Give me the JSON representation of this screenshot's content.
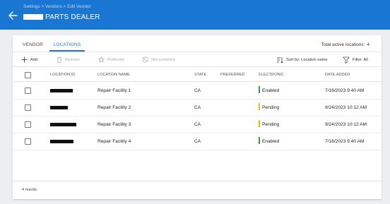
{
  "header": {
    "breadcrumb": "Settings > Vendors > Edit Vendor",
    "title": "PARTS DEALER",
    "color": "#1976d2"
  },
  "tabs": [
    {
      "label": "VENDOR",
      "active": false
    },
    {
      "label": "LOCATIONS",
      "active": true
    }
  ],
  "total_active": {
    "label": "Total active locations:",
    "value": "4"
  },
  "toolbar": {
    "add": "Add",
    "remove": "Remove",
    "preferred": "Preferred",
    "not_preferred": "Not preferred",
    "sort": "Sort by: Location name",
    "filter": "Filter: All"
  },
  "table": {
    "headers": {
      "location_id": "LOCATION ID",
      "location_name": "LOCATION NAME",
      "state": "STATE",
      "preferred": "PREFERRED",
      "electronic": "ELECTRONIC",
      "date_added": "DATE ADDED"
    },
    "rows": [
      {
        "location_name": "Repair Facility 1",
        "state": "CA",
        "preferred": "",
        "electronic": "Enabled",
        "status_color": "#2e9e3e",
        "date_added": "7/16/2023 9:40 AM"
      },
      {
        "location_name": "Repair Facility 2",
        "state": "CA",
        "preferred": "",
        "electronic": "Pending",
        "status_color": "#f5b800",
        "date_added": "9/24/2023 10:12 AM"
      },
      {
        "location_name": "Repair Facility 3",
        "state": "CA",
        "preferred": "",
        "electronic": "Pending",
        "status_color": "#f5b800",
        "date_added": "9/24/2023 10:12 AM"
      },
      {
        "location_name": "Repair Facility 4",
        "state": "CA",
        "preferred": "",
        "electronic": "Enabled",
        "status_color": "#2e9e3e",
        "date_added": "7/16/2023 9:40 AM"
      }
    ]
  },
  "footer": {
    "results": "4 results"
  },
  "icons": [
    "back-arrow-icon",
    "plus-icon",
    "trash-icon",
    "star-icon",
    "block-icon",
    "sort-icon",
    "filter-icon"
  ]
}
